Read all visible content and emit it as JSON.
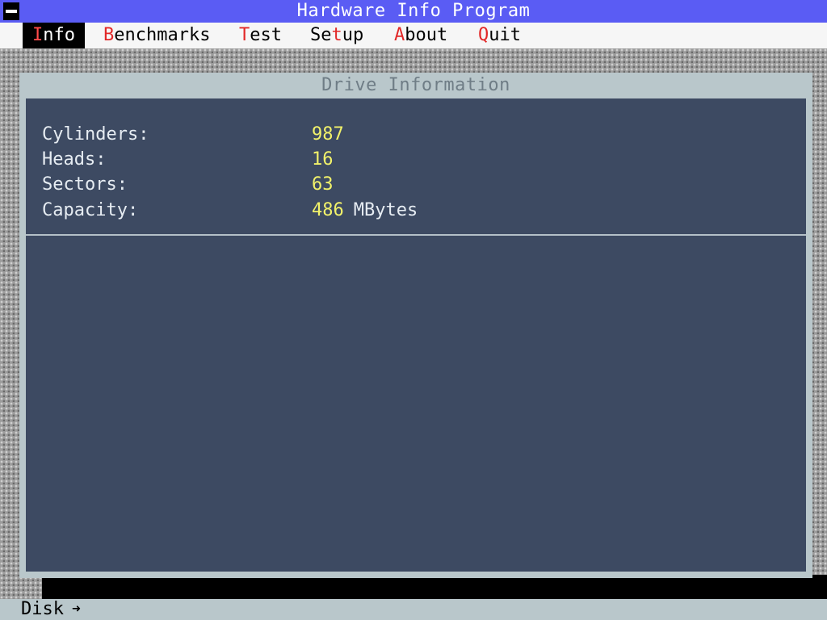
{
  "window": {
    "title": "Hardware Info Program"
  },
  "menu": {
    "items": [
      {
        "hotkey": "I",
        "rest": "nfo",
        "active": true
      },
      {
        "hotkey": "B",
        "rest": "enchmarks",
        "active": false
      },
      {
        "hotkey": "T",
        "rest": "est",
        "active": false
      },
      {
        "pre": "Se",
        "hotkey": "t",
        "rest": "up",
        "active": false
      },
      {
        "hotkey": "A",
        "rest": "bout",
        "active": false
      },
      {
        "hotkey": "Q",
        "rest": "uit",
        "active": false
      }
    ]
  },
  "drive_panel": {
    "title": "Drive Information",
    "rows": [
      {
        "label": "Cylinders:",
        "value": "987"
      },
      {
        "label": "Heads:",
        "value": "16"
      },
      {
        "label": "Sectors:",
        "value": "63"
      },
      {
        "label": "Capacity:",
        "value": "486",
        "unit": "MBytes"
      }
    ]
  },
  "status": {
    "text": "Disk",
    "icon": "arrow-right-icon",
    "icon_glyph": "➜"
  },
  "colors": {
    "titlebar": "#5a5cf4",
    "panel_bg": "#3d4a62",
    "value_text": "#f2f26a",
    "hotkey": "#e22828"
  }
}
